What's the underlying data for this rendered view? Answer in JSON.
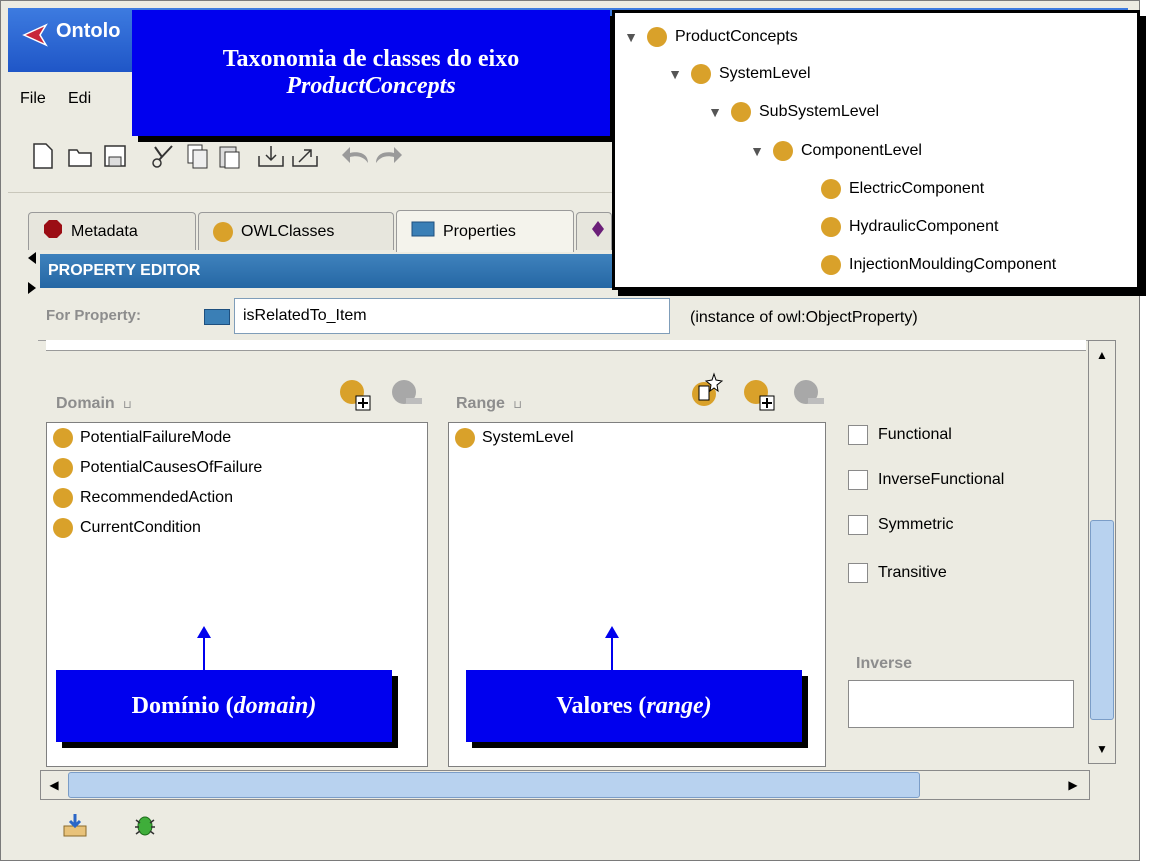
{
  "window": {
    "title": "Ontolo"
  },
  "menu": {
    "items": [
      "File",
      "Edi"
    ]
  },
  "tabs": [
    {
      "label": "Metadata",
      "icon": "metadata-diamond-icon",
      "color": "#9b0d14"
    },
    {
      "label": "OWLClasses",
      "icon": "class-circle-icon",
      "color": "#d9a12a"
    },
    {
      "label": "Properties",
      "icon": "property-rect-icon",
      "color": "#3a7fb6"
    }
  ],
  "property_editor": {
    "header": "PROPERTY EDITOR",
    "for_label": "For Property:",
    "property_name": "isRelatedTo_Item",
    "property_type": "(instance of owl:ObjectProperty)",
    "domain": {
      "label": "Domain",
      "items": [
        "PotentialFailureMode",
        "PotentialCausesOfFailure",
        "RecommendedAction",
        "CurrentCondition"
      ]
    },
    "range": {
      "label": "Range",
      "items": [
        "SystemLevel"
      ]
    },
    "characteristics": [
      "Functional",
      "InverseFunctional",
      "Symmetric",
      "Transitive"
    ],
    "inverse_label": "Inverse",
    "inverse_value": ""
  },
  "annotations": {
    "taxonomy_title_line1": "Taxonomia de classes do eixo",
    "taxonomy_title_line2": "ProductConcepts",
    "domain_callout": "Domínio (",
    "domain_callout_em": "domain)",
    "range_callout": "Valores (",
    "range_callout_em": "range)",
    "range_callout_end": ")"
  },
  "taxonomy_tree": [
    {
      "label": "ProductConcepts",
      "depth": 0,
      "expanded": true
    },
    {
      "label": "SystemLevel",
      "depth": 1,
      "expanded": true
    },
    {
      "label": "SubSystemLevel",
      "depth": 2,
      "expanded": true
    },
    {
      "label": "ComponentLevel",
      "depth": 3,
      "expanded": true
    },
    {
      "label": "ElectricComponent",
      "depth": 4,
      "expanded": false
    },
    {
      "label": "HydraulicComponent",
      "depth": 4,
      "expanded": false
    },
    {
      "label": "InjectionMouldingComponent",
      "depth": 4,
      "expanded": false
    }
  ],
  "colors": {
    "class_dot": "#d9a12a",
    "header_blue": "#2567a4",
    "callout_blue": "#0000ee"
  }
}
